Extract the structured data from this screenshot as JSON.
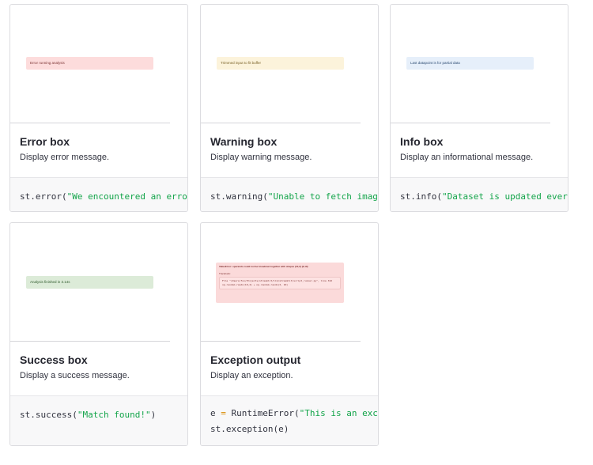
{
  "cards": [
    {
      "id": "error",
      "title": "Error box",
      "description": "Display error message.",
      "preview": {
        "text": "Error running analysis",
        "bg": "#fddcdc",
        "color": "#7d3535"
      },
      "code": [
        [
          {
            "t": "st.error(",
            "c": ""
          },
          {
            "t": "\"We encountered an error\"",
            "c": "str"
          },
          {
            "t": ")",
            "c": ""
          }
        ]
      ]
    },
    {
      "id": "warning",
      "title": "Warning box",
      "description": "Display warning message.",
      "preview": {
        "text": "Trimmed input to fit buffer",
        "bg": "#fcf3db",
        "color": "#7a6228"
      },
      "code": [
        [
          {
            "t": "st.warning(",
            "c": ""
          },
          {
            "t": "\"Unable to fetch image.\"",
            "c": "str"
          },
          {
            "t": ")",
            "c": ""
          }
        ]
      ]
    },
    {
      "id": "info",
      "title": "Info box",
      "description": "Display an informational message.",
      "preview": {
        "text": "Last datapoint is for partial data",
        "bg": "#e6effa",
        "color": "#2e4d74"
      },
      "code": [
        [
          {
            "t": "st.info(",
            "c": ""
          },
          {
            "t": "\"Dataset is updated every day at midnight.\"",
            "c": "str"
          },
          {
            "t": ")",
            "c": ""
          }
        ]
      ]
    },
    {
      "id": "success",
      "title": "Success box",
      "description": "Display a success message.",
      "preview": {
        "text": "Analysis finished in 3.14s",
        "bg": "#dcebd8",
        "color": "#2f5a2c"
      },
      "code": [
        [
          {
            "t": "st.success(",
            "c": ""
          },
          {
            "t": "\"Match found!\"",
            "c": "str"
          },
          {
            "t": ")",
            "c": ""
          }
        ]
      ]
    },
    {
      "id": "exception",
      "title": "Exception output",
      "description": "Display an exception.",
      "exception_preview": {
        "header": "ValueError: operands could not be broadcast together with shapes (10,2) (3,10)",
        "traceback_label": "Traceback:",
        "lines": [
          "File \"/Users/foo/Projects/streamlit/lib/streamlit/script_runner.py\", line 322",
          "np.random.randn(10,2) + np.random.randn(3, 10)"
        ]
      },
      "code": [
        [
          {
            "t": "e ",
            "c": ""
          },
          {
            "t": "=",
            "c": "op"
          },
          {
            "t": " RuntimeError(",
            "c": ""
          },
          {
            "t": "\"This is an exception of type RuntimeError\"",
            "c": "str"
          },
          {
            "t": ")",
            "c": ""
          }
        ],
        [
          {
            "t": "st.exception(e)",
            "c": ""
          }
        ]
      ]
    }
  ]
}
